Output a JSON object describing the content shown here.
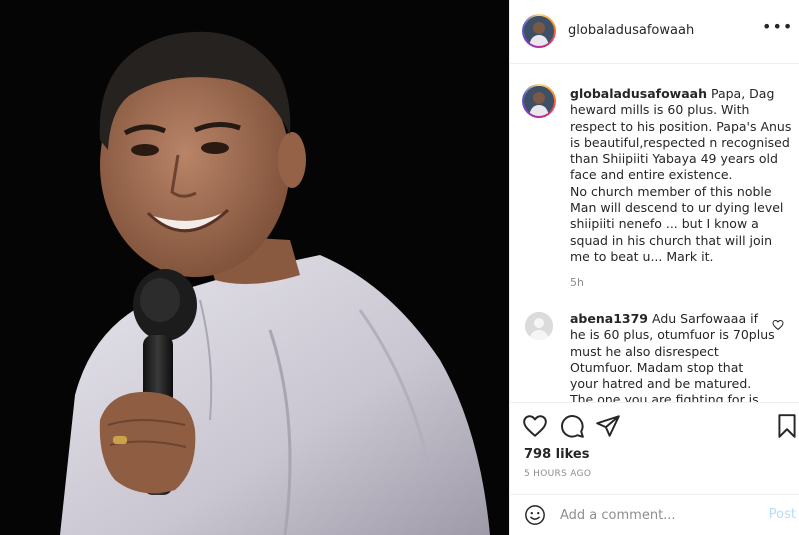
{
  "post": {
    "username": "globaladusafowaah",
    "caption_user": "globaladusafowaah",
    "caption_text": "Papa, Dag heward mills is 60 plus. With respect to his position. Papa's Anus is beautiful,respected n recognised than Shiipiiti Yabaya 49 years old face and entire existence.",
    "caption_text_2": "No church member of this noble Man will descend to ur dying level shiipiiti nenefo ... but I know a squad in his church that will join me to beat u... Mark it.",
    "caption_time": "5h",
    "comment_user": "abena1379",
    "comment_text": "Adu Sarfowaaa if he is 60 plus, otumfuor is 70plus must he also disrespect Otumfuor. Madam stop that your hatred and be matured. The one you are fighting for is",
    "likes": "798 likes",
    "time_ago": "5 HOURS AGO",
    "add_comment_placeholder": "Add a comment...",
    "post_label": "Post"
  },
  "icons": {
    "more": "more-options-icon",
    "like": "heart-icon",
    "comment": "comment-icon",
    "share": "share-icon",
    "save": "bookmark-icon",
    "emoji": "emoji-icon"
  },
  "colors": {
    "post_button_disabled": "#b2dffc",
    "secondary_text": "#8e8e8e",
    "primary_text": "#262626"
  }
}
